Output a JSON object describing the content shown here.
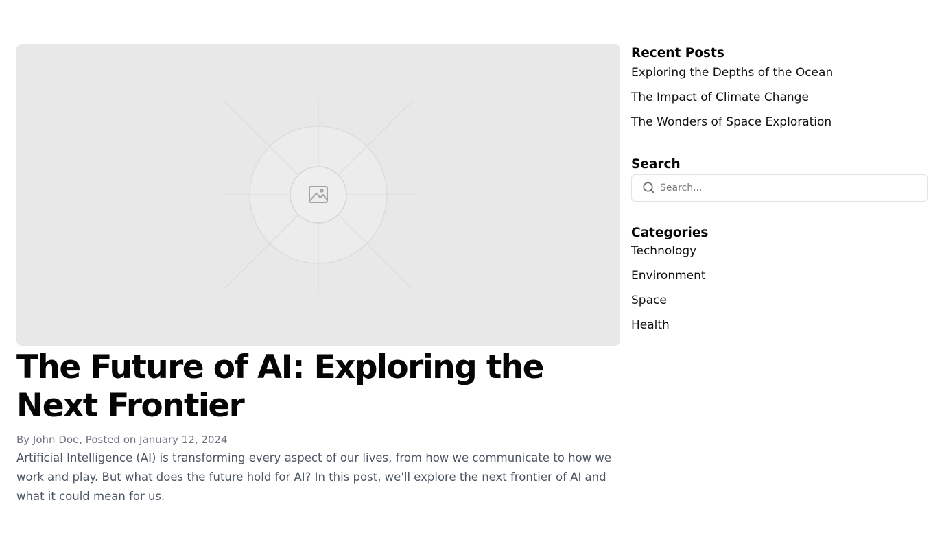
{
  "post": {
    "hero_image_alt": "placeholder-image",
    "title": "The Future of AI: Exploring the Next Frontier",
    "byline": "By John Doe, Posted on January 12, 2024",
    "excerpt": "Artificial Intelligence (AI) is transforming every aspect of our lives, from how we communicate to how we work and play. But what does the future hold for AI? In this post, we'll explore the next frontier of AI and what it could mean for us."
  },
  "sidebar": {
    "recent_posts": {
      "title": "Recent Posts",
      "items": [
        {
          "label": "Exploring the Depths of the Ocean"
        },
        {
          "label": "The Impact of Climate Change"
        },
        {
          "label": "The Wonders of Space Exploration"
        }
      ]
    },
    "search": {
      "title": "Search",
      "placeholder": "Search...",
      "value": "",
      "icon": "search-icon"
    },
    "categories": {
      "title": "Categories",
      "items": [
        {
          "label": "Technology"
        },
        {
          "label": "Environment"
        },
        {
          "label": "Space"
        },
        {
          "label": "Health"
        }
      ]
    }
  },
  "colors": {
    "background": "#ffffff",
    "hero_placeholder": "#e8e8e8",
    "heading": "#050505",
    "byline": "#6b7280",
    "body_text": "#4b5563",
    "input_border": "#e3e3e3"
  }
}
